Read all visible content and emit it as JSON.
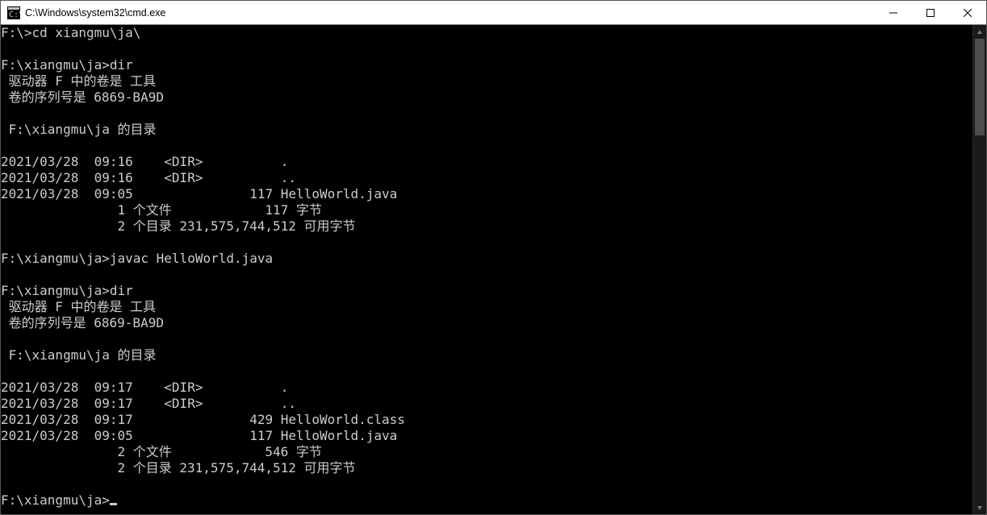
{
  "window": {
    "title": "C:\\Windows\\system32\\cmd.exe"
  },
  "terminal": {
    "lines": [
      "F:\\>cd xiangmu\\ja\\",
      "",
      "F:\\xiangmu\\ja>dir",
      " 驱动器 F 中的卷是 工具",
      " 卷的序列号是 6869-BA9D",
      "",
      " F:\\xiangmu\\ja 的目录",
      "",
      "2021/03/28  09:16    <DIR>          .",
      "2021/03/28  09:16    <DIR>          ..",
      "2021/03/28  09:05               117 HelloWorld.java",
      "               1 个文件            117 字节",
      "               2 个目录 231,575,744,512 可用字节",
      "",
      "F:\\xiangmu\\ja>javac HelloWorld.java",
      "",
      "F:\\xiangmu\\ja>dir",
      " 驱动器 F 中的卷是 工具",
      " 卷的序列号是 6869-BA9D",
      "",
      " F:\\xiangmu\\ja 的目录",
      "",
      "2021/03/28  09:17    <DIR>          .",
      "2021/03/28  09:17    <DIR>          ..",
      "2021/03/28  09:17               429 HelloWorld.class",
      "2021/03/28  09:05               117 HelloWorld.java",
      "               2 个文件            546 字节",
      "               2 个目录 231,575,744,512 可用字节",
      "",
      "F:\\xiangmu\\ja>"
    ]
  }
}
